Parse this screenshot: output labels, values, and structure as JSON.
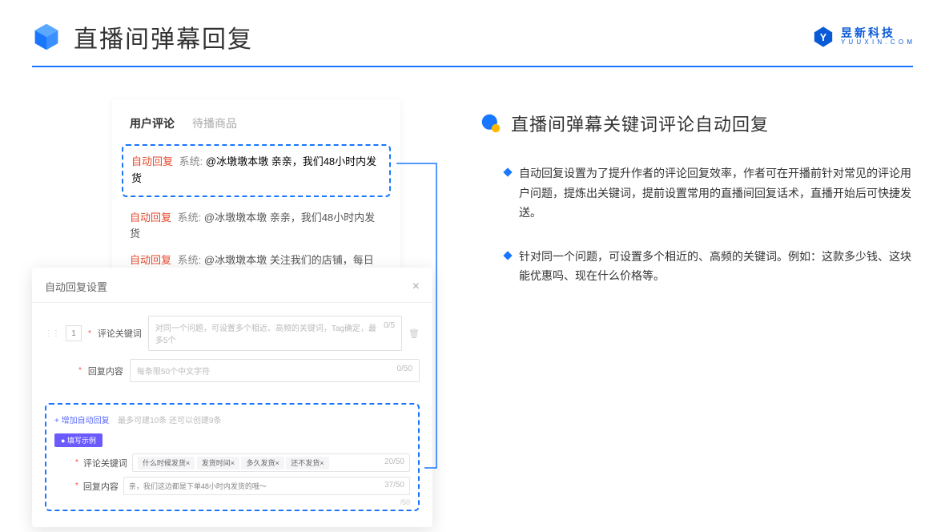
{
  "header": {
    "title": "直播间弹幕回复",
    "brand_name": "昱新科技",
    "brand_sub": "Y U U X I N . C O M"
  },
  "comments": {
    "tab_active": "用户评论",
    "tab_inactive": "待播商品",
    "auto_reply_tag": "自动回复",
    "sys_label": "系统:",
    "highlight_msg": "@冰墩墩本墩 亲亲，我们48小时内发货",
    "line2": "@冰墩墩本墩 亲亲，我们48小时内发货",
    "line3": "@冰墩墩本墩 关注我们的店铺，每日都有热门推荐呦～"
  },
  "modal": {
    "title": "自动回复设置",
    "index": "1",
    "kw_label": "评论关键词",
    "kw_placeholder": "对同一个问题，可设置多个相近、高频的关键词，Tag确定，最多5个",
    "kw_counter": "0/5",
    "content_label": "回复内容",
    "content_placeholder": "每条限50个中文字符",
    "content_counter": "0/50",
    "add_link": "+ 增加自动回复",
    "add_hint": "最多可建10条 还可以创建9条",
    "example_badge": "● 填写示例",
    "ex_kw_label": "评论关键词",
    "ex_tags": [
      "什么时候发货×",
      "发货时间×",
      "多久发货×",
      "还不发货×"
    ],
    "ex_kw_counter": "20/50",
    "ex_content_label": "回复内容",
    "ex_content_text": "亲，我们这边都是下单48小时内发货的哦～",
    "ex_content_counter": "37/50",
    "outer_counter": "/50"
  },
  "right": {
    "section_title": "直播间弹幕关键词评论自动回复",
    "bullet1": "自动回复设置为了提升作者的评论回复效率，作者可在开播前针对常见的评论用户问题，提炼出关键词，提前设置常用的直播间回复话术，直播开始后可快捷发送。",
    "bullet2": "针对同一个问题，可设置多个相近的、高频的关键词。例如：这款多少钱、这块能优惠吗、现在什么价格等。"
  }
}
